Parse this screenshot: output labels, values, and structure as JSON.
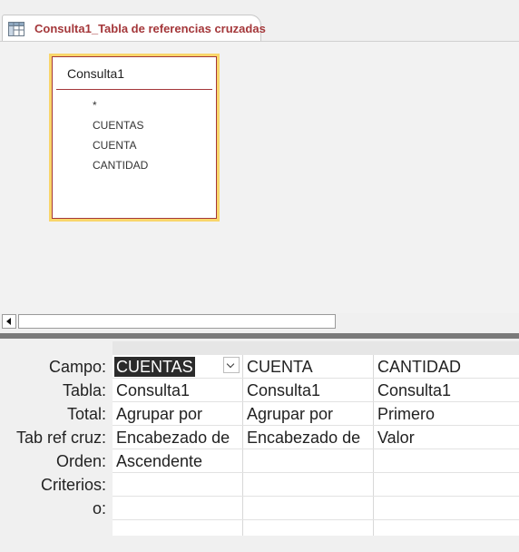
{
  "tab": {
    "title": "Consulta1_Tabla de referencias cruzadas",
    "icon": "crosstab-query-icon"
  },
  "field_list": {
    "title": "Consulta1",
    "items": [
      "*",
      "CUENTAS",
      "CUENTA",
      "CANTIDAD"
    ]
  },
  "grid": {
    "row_labels": [
      "Campo:",
      "Tabla:",
      "Total:",
      "Tab ref cruz:",
      "Orden:",
      "Criterios:",
      "o:"
    ],
    "columns": [
      {
        "campo": "CUENTAS",
        "tabla": "Consulta1",
        "total": "Agrupar por",
        "tab_ref_cruz": "Encabezado de",
        "orden": "Ascendente",
        "criterios": "",
        "o": ""
      },
      {
        "campo": "CUENTA",
        "tabla": "Consulta1",
        "total": "Agrupar por",
        "tab_ref_cruz": "Encabezado de",
        "orden": "",
        "criterios": "",
        "o": ""
      },
      {
        "campo": "CANTIDAD",
        "tabla": "Consulta1",
        "total": "Primero",
        "tab_ref_cruz": "Valor",
        "orden": "",
        "criterios": "",
        "o": ""
      }
    ]
  },
  "colors": {
    "accent": "#a4373a",
    "field_list_highlight": "#f9d66a",
    "selection": "#2b2b2b"
  }
}
